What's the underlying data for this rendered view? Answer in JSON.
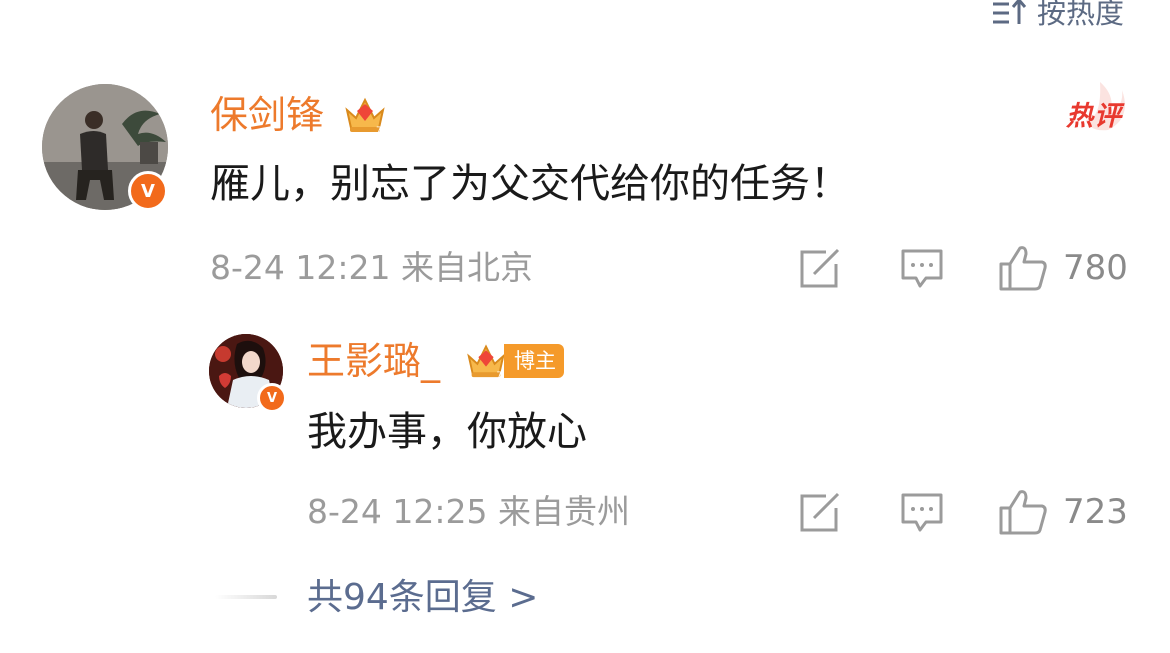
{
  "sort": {
    "label": "按热度",
    "icon": "sort-arrow-icon"
  },
  "comment": {
    "username": "保剑锋",
    "verified_badge": "V",
    "hot_label": "热评",
    "text": "雁儿，别忘了为父交代给你的任务！",
    "date": "8-24",
    "time": "12:21",
    "location": "来自北京",
    "like_count": "780",
    "accent_color": "#ed7a2c"
  },
  "reply": {
    "username": "王影璐_",
    "badge": "博主",
    "verified_badge": "V",
    "text": "我办事，你放心",
    "date": "8-24",
    "time": "12:25",
    "location": "来自贵州",
    "like_count": "723"
  },
  "more_replies": {
    "label": "共94条回复 >"
  },
  "icons": [
    "sort-arrow-icon",
    "crown-icon",
    "share-icon",
    "comment-icon",
    "like-icon",
    "verified-icon"
  ]
}
